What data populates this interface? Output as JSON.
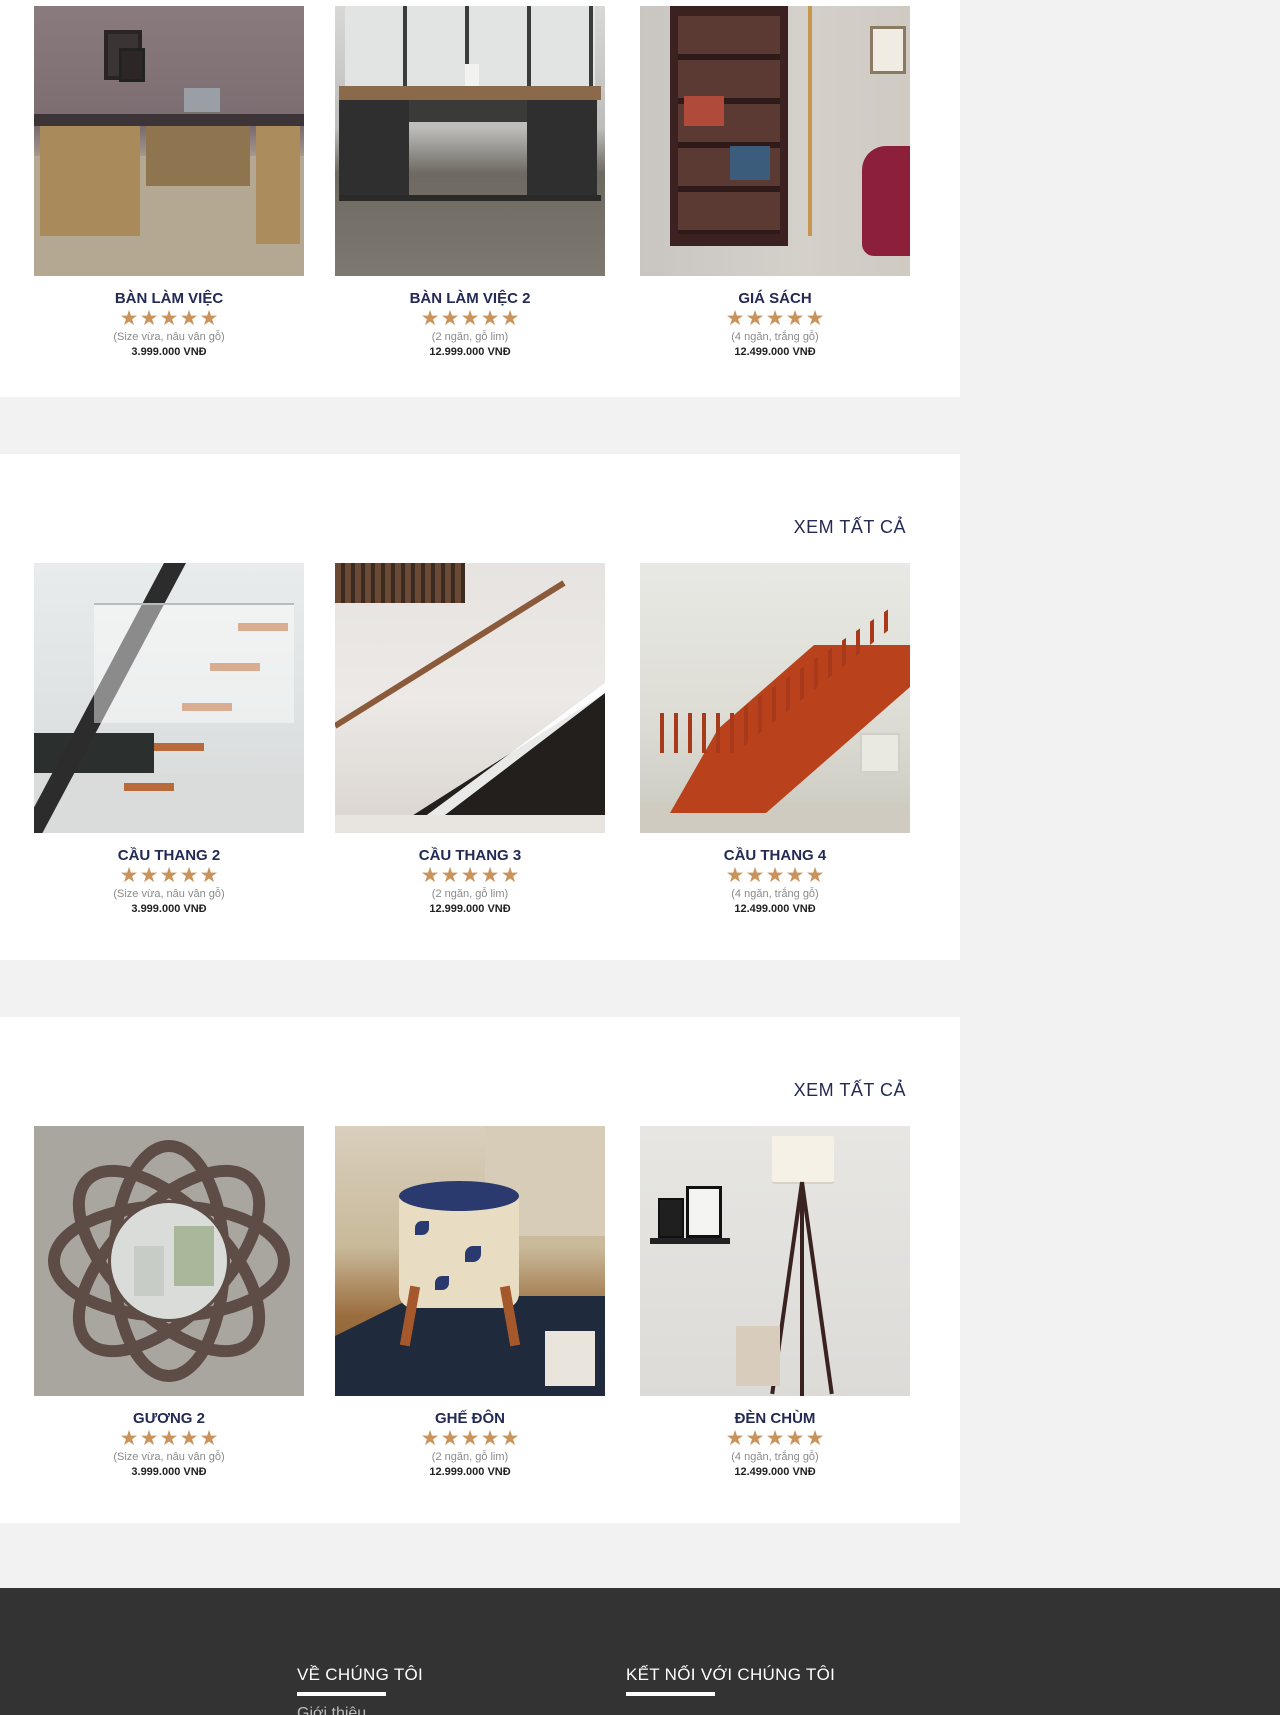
{
  "sections": [
    {
      "view_all": "",
      "products": [
        {
          "name": "BÀN LÀM VIỆC",
          "desc": "(Size vừa, nâu vân gỗ)",
          "price": "3.999.000 VNĐ",
          "rating": 5,
          "image": "l-shaped-desk-image"
        },
        {
          "name": "BÀN LÀM VIỆC 2",
          "desc": "(2 ngăn, gỗ lim)",
          "price": "12.999.000 VNĐ",
          "rating": 5,
          "image": "industrial-desk-image"
        },
        {
          "name": "GIÁ SÁCH",
          "desc": "(4 ngăn, trắng gỗ)",
          "price": "12.499.000 VNĐ",
          "rating": 5,
          "image": "bookshelf-image"
        }
      ]
    },
    {
      "view_all": "XEM TẤT CẢ",
      "products": [
        {
          "name": "CẦU THANG 2",
          "desc": "(Size vừa, nâu vân gỗ)",
          "price": "3.999.000 VNĐ",
          "rating": 5,
          "image": "glass-staircase-image"
        },
        {
          "name": "CẦU THANG 3",
          "desc": "(2 ngăn, gỗ lim)",
          "price": "12.999.000 VNĐ",
          "rating": 5,
          "image": "storage-staircase-image"
        },
        {
          "name": "CẦU THANG 4",
          "desc": "(4 ngăn, trắng gỗ)",
          "price": "12.499.000 VNĐ",
          "rating": 5,
          "image": "wooden-staircase-image"
        }
      ]
    },
    {
      "view_all": "XEM TẤT CẢ",
      "products": [
        {
          "name": "GƯƠNG 2",
          "desc": "(Size vừa, nâu vân gỗ)",
          "price": "3.999.000 VNĐ",
          "rating": 5,
          "image": "decorative-mirror-image"
        },
        {
          "name": "GHẾ ĐÔN",
          "desc": "(2 ngăn, gỗ lim)",
          "price": "12.999.000 VNĐ",
          "rating": 5,
          "image": "floral-stool-image"
        },
        {
          "name": "ĐÈN CHÙM",
          "desc": "(4 ngăn, trắng gỗ)",
          "price": "12.499.000 VNĐ",
          "rating": 5,
          "image": "floor-lamp-image"
        }
      ]
    }
  ],
  "footer": {
    "about_title": "VỀ CHÚNG TÔI",
    "about_link": "Giới thiệu",
    "connect_title": "KẾT NỐI VỚI CHÚNG TÔI"
  },
  "colors": {
    "primary_text": "#232a54",
    "star": "#c9935b",
    "page_bg": "#f2f2f2",
    "footer_bg": "#333333"
  }
}
